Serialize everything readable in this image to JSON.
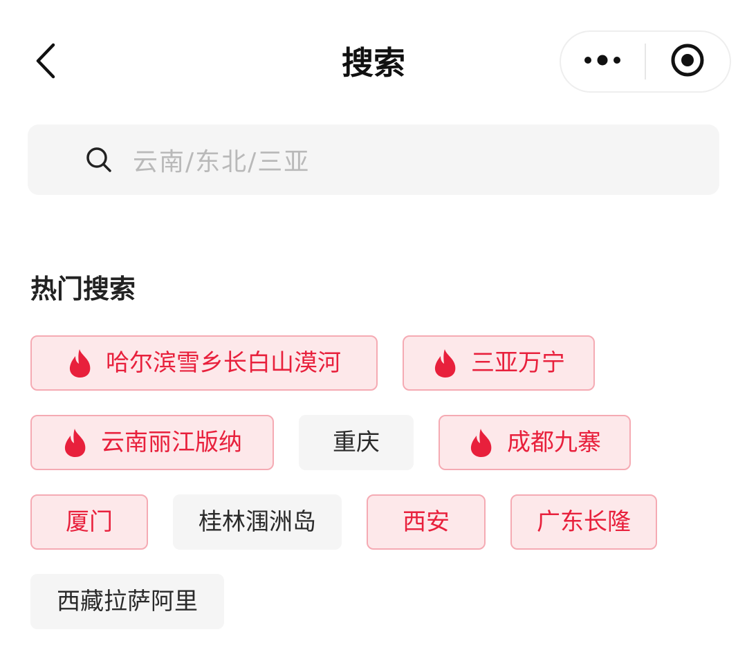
{
  "header": {
    "title": "搜索",
    "back_icon": "chevron-left-icon",
    "more_icon": "more-dots-icon",
    "close_icon": "target-circle-icon"
  },
  "search": {
    "placeholder": "云南/东北/三亚",
    "icon": "search-icon"
  },
  "hot_search": {
    "title": "热门搜索",
    "hot_color": "#e8203c",
    "tags": [
      {
        "label": "哈尔滨雪乡长白山漠河",
        "hot": true
      },
      {
        "label": "三亚万宁",
        "hot": true
      },
      {
        "label": "云南丽江版纳",
        "hot": true
      },
      {
        "label": "重庆",
        "hot": false
      },
      {
        "label": "成都九寨",
        "hot": true
      },
      {
        "label": "厦门",
        "hot": true
      },
      {
        "label": "桂林涠洲岛",
        "hot": false
      },
      {
        "label": "西安",
        "hot": true
      },
      {
        "label": "广东长隆",
        "hot": true
      },
      {
        "label": "西藏拉萨阿里",
        "hot": false
      }
    ]
  }
}
